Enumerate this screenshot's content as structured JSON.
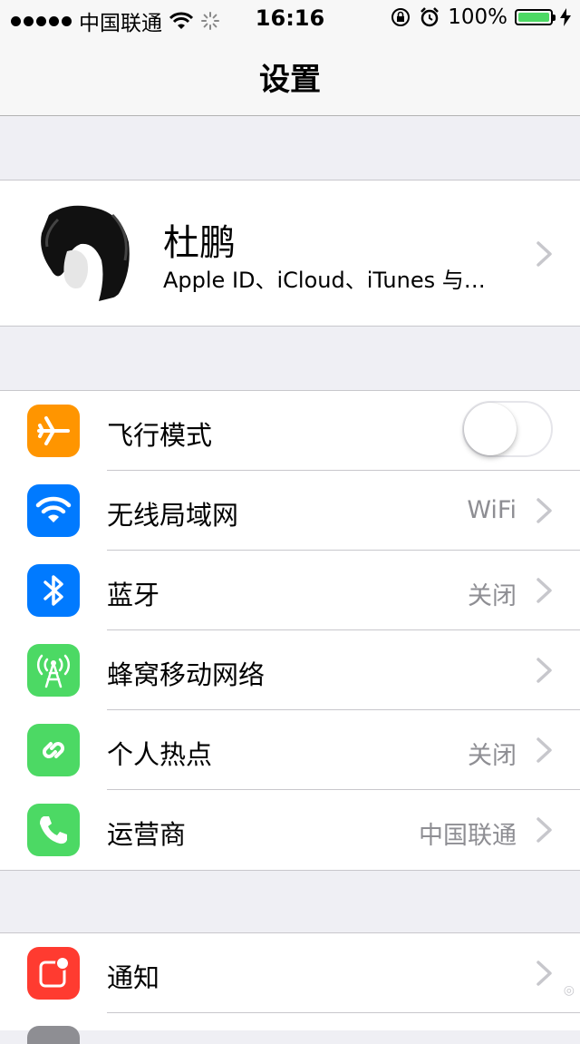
{
  "status_bar": {
    "carrier": "中国联通",
    "time": "16:16",
    "battery": "100%"
  },
  "nav": {
    "title": "设置"
  },
  "profile": {
    "name": "杜鹏",
    "subtitle": "Apple ID、iCloud、iTunes 与…"
  },
  "network_group": {
    "airplane": {
      "label": "飞行模式",
      "toggle_on": false
    },
    "wifi": {
      "label": "无线局域网",
      "value": "WiFi"
    },
    "bluetooth": {
      "label": "蓝牙",
      "value": "关闭"
    },
    "cellular": {
      "label": "蜂窝移动网络"
    },
    "hotspot": {
      "label": "个人热点",
      "value": "关闭"
    },
    "carrier": {
      "label": "运营商",
      "value": "中国联通"
    }
  },
  "notification_group": {
    "notifications": {
      "label": "通知"
    }
  },
  "icons": {
    "airplane": "airplane-icon",
    "wifi": "wifi-icon",
    "bluetooth": "bluetooth-icon",
    "cellular": "cellular-antenna-icon",
    "hotspot": "hotspot-link-icon",
    "carrier": "phone-icon",
    "notifications": "notifications-icon"
  },
  "colors": {
    "airplane": "#ff9500",
    "wifi": "#007aff",
    "bluetooth": "#007aff",
    "cellular": "#4cd964",
    "hotspot": "#4cd964",
    "carrier": "#4cd964",
    "notifications": "#ff3b30",
    "battery": "#4cd964"
  }
}
